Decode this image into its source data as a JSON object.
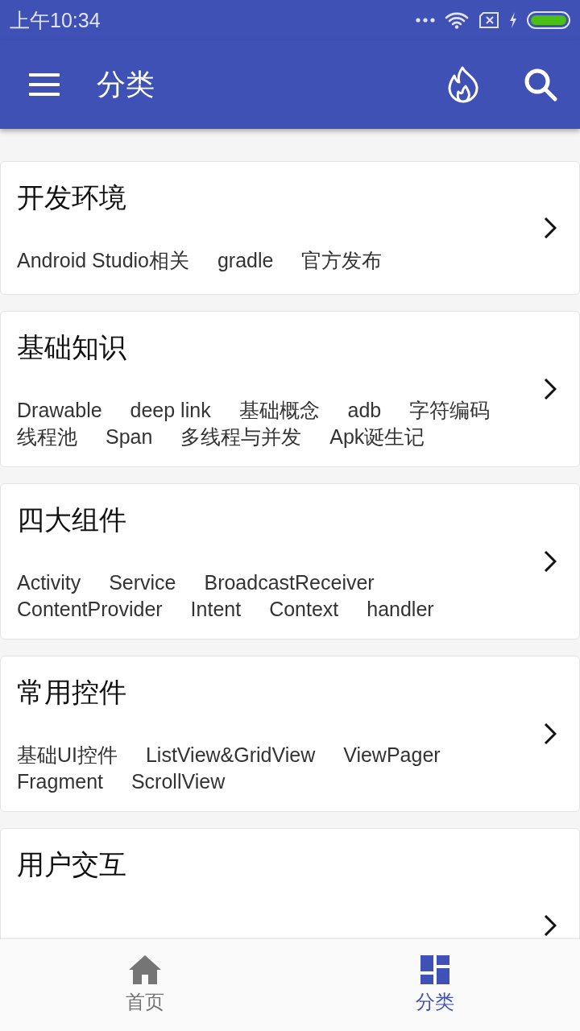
{
  "status_bar": {
    "time": "上午10:34"
  },
  "app_bar": {
    "title": "分类"
  },
  "categories": [
    {
      "title": "开发环境",
      "tags": [
        "Android Studio相关",
        "gradle",
        "官方发布"
      ]
    },
    {
      "title": "基础知识",
      "tags": [
        "Drawable",
        "deep link",
        "基础概念",
        "adb",
        "字符编码",
        "线程池",
        "Span",
        "多线程与并发",
        "Apk诞生记"
      ]
    },
    {
      "title": "四大组件",
      "tags": [
        "Activity",
        "Service",
        "BroadcastReceiver",
        "ContentProvider",
        "Intent",
        "Context",
        "handler"
      ]
    },
    {
      "title": "常用控件",
      "tags": [
        "基础UI控件",
        "ListView&GridView",
        "ViewPager",
        "Fragment",
        "ScrollView"
      ]
    },
    {
      "title": "用户交互"
    }
  ],
  "bottom_nav": [
    {
      "label": "首页",
      "kind": "home",
      "selected": false
    },
    {
      "label": "分类",
      "kind": "category",
      "selected": true
    }
  ]
}
